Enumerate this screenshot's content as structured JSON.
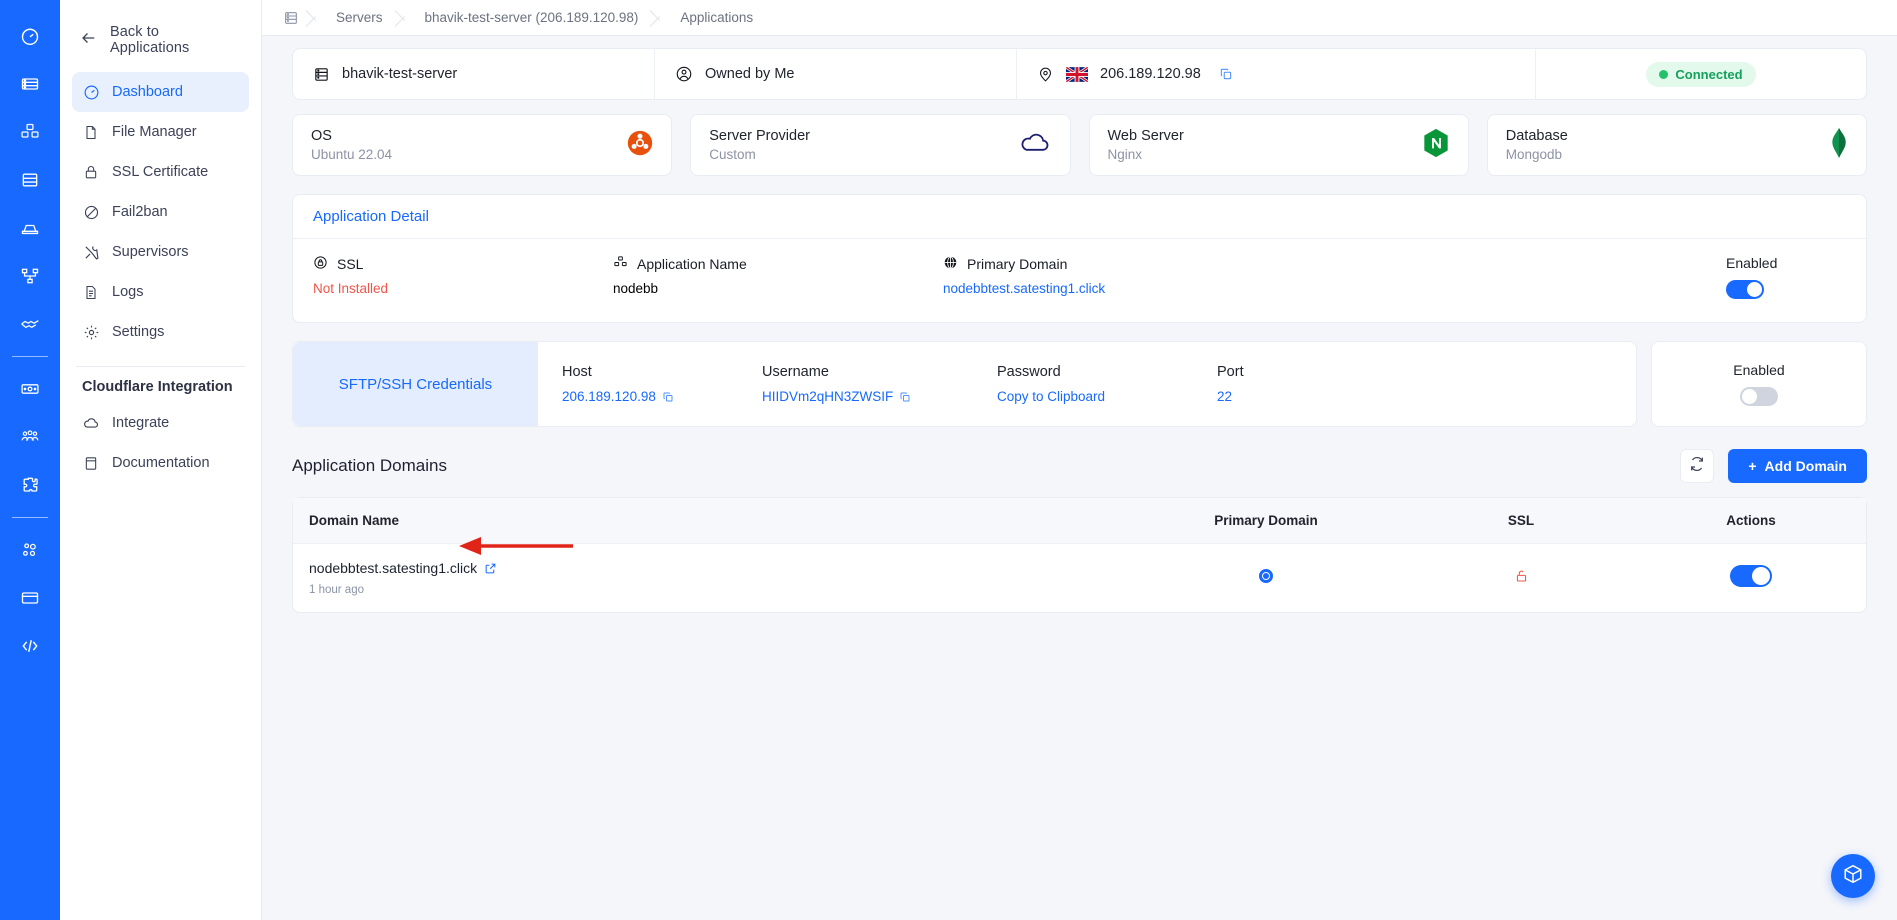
{
  "rail": {
    "items": [
      {
        "name": "dashboard-icon"
      },
      {
        "name": "servers-icon"
      },
      {
        "name": "applications-icon"
      },
      {
        "name": "database-icon"
      },
      {
        "name": "backups-icon"
      },
      {
        "name": "network-icon"
      },
      {
        "name": "partners-icon"
      },
      {
        "name": "billing-icon"
      },
      {
        "name": "team-icon"
      },
      {
        "name": "integrations-icon"
      },
      {
        "name": "settings-nodes-icon"
      },
      {
        "name": "monitor-icon"
      },
      {
        "name": "api-icon"
      }
    ]
  },
  "sidebar": {
    "back_label": "Back to Applications",
    "items": [
      {
        "label": "Dashboard",
        "icon": "gauge-icon",
        "active": true
      },
      {
        "label": "File Manager",
        "icon": "file-icon",
        "active": false
      },
      {
        "label": "SSL Certificate",
        "icon": "lock-icon",
        "active": false
      },
      {
        "label": "Fail2ban",
        "icon": "ban-icon",
        "active": false
      },
      {
        "label": "Supervisors",
        "icon": "tools-icon",
        "active": false
      },
      {
        "label": "Logs",
        "icon": "document-icon",
        "active": false
      },
      {
        "label": "Settings",
        "icon": "gear-icon",
        "active": false
      }
    ],
    "section_title": "Cloudflare Integration",
    "section_items": [
      {
        "label": "Integrate",
        "icon": "cloud-icon"
      },
      {
        "label": "Documentation",
        "icon": "book-icon"
      }
    ]
  },
  "breadcrumb": {
    "icon": "server-rack-icon",
    "items": [
      "Servers",
      "bhavik-test-server (206.189.120.98)",
      "Applications"
    ]
  },
  "server_strip": {
    "server_name": "bhavik-test-server",
    "owner": "Owned by Me",
    "ip": "206.189.120.98",
    "copy_label": "copy-icon",
    "status": "Connected",
    "status_color": "#15a05b"
  },
  "info_cards": [
    {
      "label": "OS",
      "value": "Ubuntu 22.04",
      "icon": "ubuntu-logo"
    },
    {
      "label": "Server Provider",
      "value": "Custom",
      "icon": "cloud-logo"
    },
    {
      "label": "Web Server",
      "value": "Nginx",
      "icon": "nginx-logo"
    },
    {
      "label": "Database",
      "value": "Mongodb",
      "icon": "mongodb-logo"
    }
  ],
  "application_detail": {
    "title": "Application Detail",
    "ssl": {
      "label": "SSL",
      "value": "Not Installed",
      "icon": "ssl-lock-icon",
      "value_color": "#f0564a"
    },
    "app_name": {
      "label": "Application Name",
      "value": "nodebb",
      "icon": "app-cubes-icon"
    },
    "primary_domain": {
      "label": "Primary Domain",
      "value": "nodebbtest.satesting1.click",
      "icon": "globe-icon",
      "value_color": "#1769ff"
    },
    "enabled": {
      "label": "Enabled",
      "state": "on"
    }
  },
  "sftp": {
    "title": "SFTP/SSH Credentials",
    "fields": [
      {
        "label": "Host",
        "value": "206.189.120.98",
        "copy": true
      },
      {
        "label": "Username",
        "value": "HIIDVm2qHN3ZWSIF",
        "copy": true
      },
      {
        "label": "Password",
        "value": "Copy to Clipboard",
        "copy": false
      },
      {
        "label": "Port",
        "value": "22",
        "copy": false
      }
    ],
    "enabled": {
      "label": "Enabled",
      "state": "off"
    }
  },
  "domains": {
    "title": "Application Domains",
    "refresh_label": "refresh-icon",
    "add_label": "Add Domain",
    "columns": [
      "Domain Name",
      "Primary Domain",
      "SSL",
      "Actions"
    ],
    "rows": [
      {
        "domain": "nodebbtest.satesting1.click",
        "time": "1 hour ago",
        "primary": true,
        "ssl": "unlocked",
        "enabled": "on"
      }
    ]
  },
  "chat": {
    "label": "chat-support-icon"
  },
  "annotation": {
    "arrow_color": "#e02418"
  }
}
